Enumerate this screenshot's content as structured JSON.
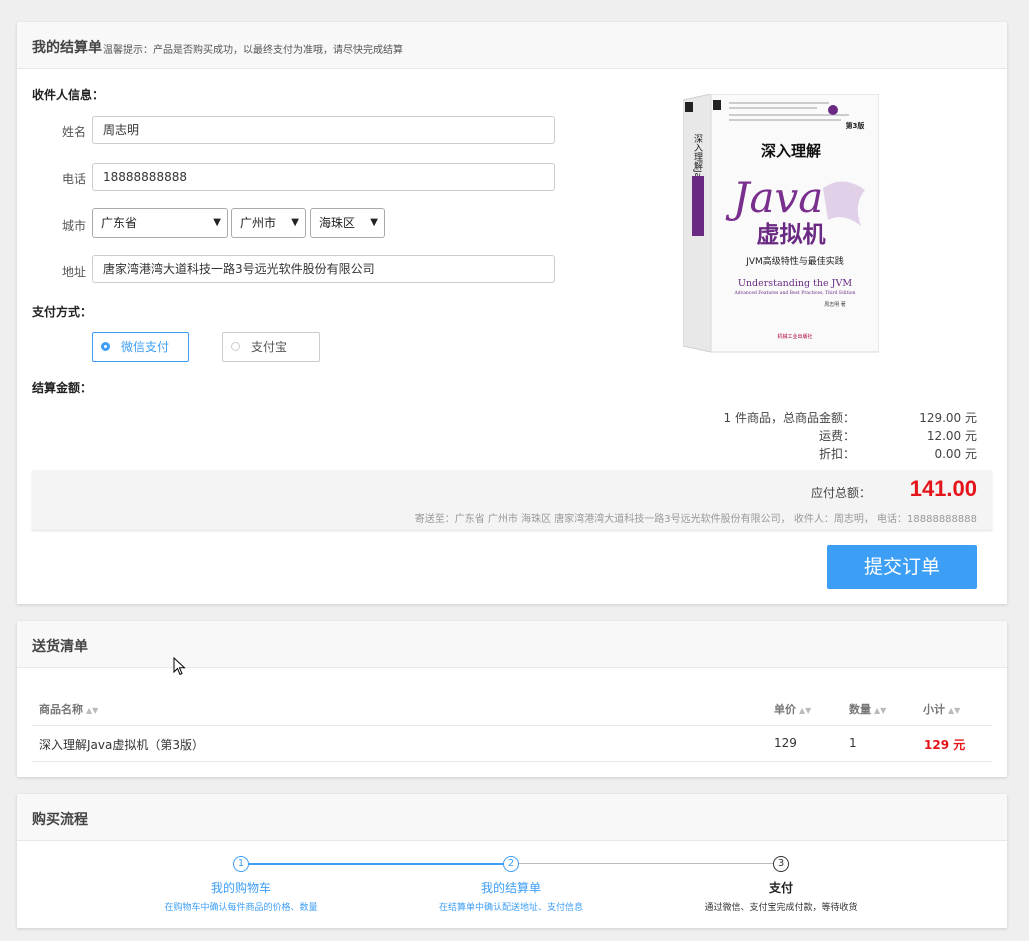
{
  "checkout": {
    "title": "我的结算单",
    "tip": "温馨提示：产品是否购买成功，以最终支付为准哦，请尽快完成结算",
    "receiver_label": "收件人信息：",
    "name_label": "姓名",
    "name_value": "周志明",
    "phone_label": "电话",
    "phone_value": "18888888888",
    "city_label": "城市",
    "province": "广东省",
    "city": "广州市",
    "district": "海珠区",
    "address_label": "地址",
    "address_value": "唐家湾港湾大道科技一路3号远光软件股份有限公司",
    "payment_label": "支付方式：",
    "payment_options": [
      {
        "label": "微信支付",
        "selected": true
      },
      {
        "label": "支付宝",
        "selected": false
      }
    ],
    "amount_label": "结算金额：",
    "summary": [
      {
        "label": "1 件商品，总商品金额：",
        "value": "129.00 元"
      },
      {
        "label": "运费：",
        "value": "12.00 元"
      },
      {
        "label": "折扣：",
        "value": "0.00 元"
      }
    ],
    "total_label": "应付总额：",
    "total_value": "141.00",
    "ship_to": "寄送至：广东省 广州市 海珠区 唐家湾港湾大道科技一路3号远光软件股份有限公司， 收件人：周志明， 电话：18888888888",
    "submit_label": "提交订单"
  },
  "book": {
    "spine_title": "深入理解Java虚拟机",
    "title_line1": "深入理解",
    "title_java": "Java",
    "title_line2": "虚拟机",
    "subtitle": "JVM高级特性与最佳实践",
    "en_title": "Understanding the JVM",
    "en_subtitle": "Advanced Features and Best Practices, Third Edition",
    "edition": "第3版",
    "author": "周志明 著",
    "publisher": "机械工业出版社"
  },
  "delivery": {
    "title": "送货清单",
    "columns": [
      "商品名称",
      "单价",
      "数量",
      "小计"
    ],
    "rows": [
      {
        "name": "深入理解Java虚拟机（第3版）",
        "price": "129",
        "qty": "1",
        "subtotal": "129 元"
      }
    ]
  },
  "flow": {
    "title": "购买流程",
    "steps": [
      {
        "num": "1",
        "title": "我的购物车",
        "desc": "在购物车中确认每件商品的价格、数量"
      },
      {
        "num": "2",
        "title": "我的结算单",
        "desc": "在结算单中确认配送地址、支付信息"
      },
      {
        "num": "3",
        "title": "支付",
        "desc": "通过微信、支付宝完成付款，等待收货"
      }
    ]
  },
  "colors": {
    "accent": "#3d9ef5",
    "price": "#e4141a"
  }
}
